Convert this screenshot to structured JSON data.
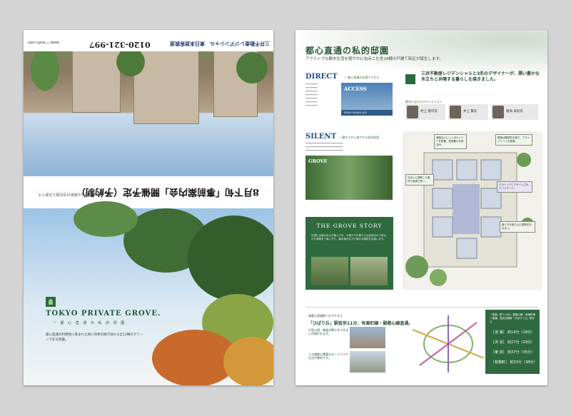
{
  "left_sheet": {
    "flipped_half": {
      "headline": "8月下旬「事前案内会」開催予定（予約制）",
      "note": "※写真は公開前の当社施工写真です。",
      "phone": "0120-321-997",
      "web": "www.ー-kishi.com",
      "brands": "三井不動産レジデンシャル　東日本旅客鉄道"
    },
    "brand_title": "TOKYO PRIVATE GROVE.",
    "brand_subtitle": "一 都 心 直 通 の 私 的 邸 園",
    "lead": "都心直通の利便性に恵まれ立地に四季の緑が溢れる全12棟のグリーンで彩る邸園。"
  },
  "right_sheet": {
    "title": "都心直通の私的邸園",
    "subtitle": "アクティブな都市生活を穏やかに包みこむ全18棟の戸建て街区が誕生します。",
    "intro": "三井不動産レジデンシャルと3名のデザイナーが、潤い豊かな木立ちと共鳴する暮らしを描きました。",
    "designers_label": "都市に広がるスペシャリスト",
    "designers": [
      "村上 隆司氏",
      "井上 賢氏",
      "雅海 美紀氏"
    ],
    "direct": {
      "title": "DIRECT",
      "label": "― 都心直通の交通アクセス",
      "access_label": "ACCESS",
      "station_label": "EBISU GAOKA 445"
    },
    "silent": {
      "title": "SILENT",
      "label": "― 静かさから遠ざかる私的邸園",
      "grove_label": "GROVE"
    },
    "story": {
      "title": "THE GROVE STORY",
      "text": "広場には緑の木々が植えられ、大樹やその周りには全体の中で育まれた時間を丁寧に守り、森の緑が生きた静かな環境を目指します。"
    },
    "callouts": [
      "道路沿いにシンボルツリーを配置。表情豊かな街並み。",
      "壁面は開放的な造り。プライバシーにも配慮。",
      "住まいに調和した素材や色調で統一。",
      "クラシックにデザインされたファサード。",
      "緑と光を取り込む開放的な住まい。"
    ],
    "access": {
      "header": "各都心直通駅へのアクセス",
      "main": "「ひばり丘」駅徒歩11分、有楽町線・副都心線直通。",
      "sub1": "大型公園、緑道が隣り合う住まいが描かれます。",
      "sub2": "バス路線も豊富なターミナルで生活が便利です。"
    },
    "timebox": {
      "header": "「池袋」駅へ14分、副都心線・有楽町線へ直通。西武池袋線「ひばりヶ丘」駅から",
      "rows": [
        "［池 袋］ 約14分〈18分〉",
        "［渋 谷］ 約27分〈29分〉",
        "［東 京］ 約37分〈35分〉",
        "［有楽町］ 約33分〈38分〉"
      ]
    }
  }
}
